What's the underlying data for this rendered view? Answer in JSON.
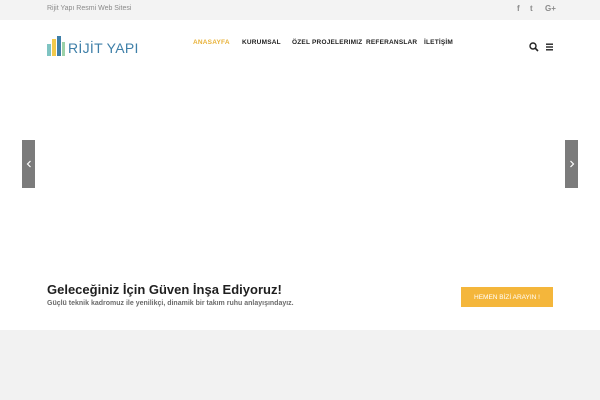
{
  "topbar": {
    "tagline": "Rijit Yapı Resmi Web Sitesi",
    "social": [
      {
        "icon": "facebook-icon",
        "glyph": "f"
      },
      {
        "icon": "twitter-icon",
        "glyph": "t"
      },
      {
        "icon": "google-plus-icon",
        "glyph": "G+"
      }
    ]
  },
  "header": {
    "logo_text": "RİJİT YAPI",
    "nav": [
      {
        "label": "ANASAYFA",
        "active": true
      },
      {
        "label": "KURUMSAL",
        "active": false
      },
      {
        "label": "ÖZEL PROJELERIMIZ",
        "active": false
      },
      {
        "label": "REFERANSLAR",
        "active": false
      },
      {
        "label": "İLETİŞİM",
        "active": false
      }
    ],
    "icons": [
      "search-icon",
      "menu-icon"
    ]
  },
  "slider": {
    "headline": "Geleceğiniz İçin Güven İnşa Ediyoruz!",
    "subline": "Güçlü teknik kadromuz ile yenilikçi, dinamik bir takım ruhu anlayışındayız.",
    "cta_label": "HEMEN BİZİ ARAYIN !",
    "arrows": [
      "prev-arrow-icon",
      "next-arrow-icon"
    ]
  },
  "colors": {
    "accent": "#f4b63b",
    "active_nav": "#e8b23a",
    "logo": "#3e7fa8",
    "topbar_bg": "#f3f3f3",
    "arrow_bg": "#7b7b7b"
  }
}
